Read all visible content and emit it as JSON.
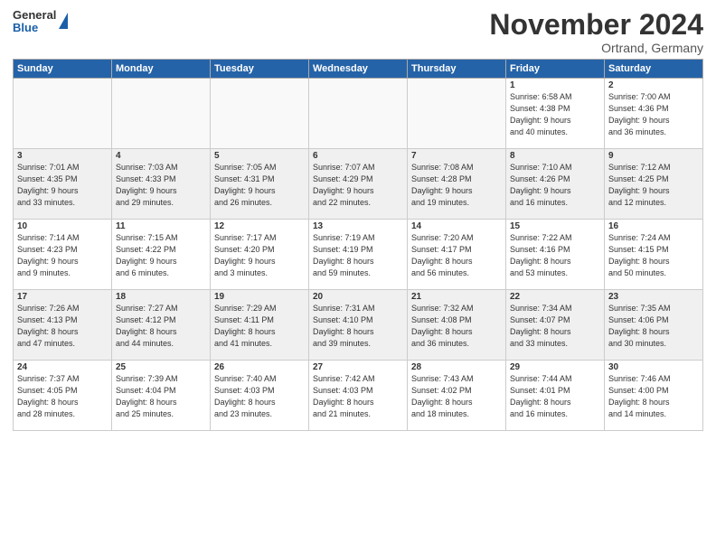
{
  "header": {
    "logo_general": "General",
    "logo_blue": "Blue",
    "month_title": "November 2024",
    "subtitle": "Ortrand, Germany"
  },
  "days_of_week": [
    "Sunday",
    "Monday",
    "Tuesday",
    "Wednesday",
    "Thursday",
    "Friday",
    "Saturday"
  ],
  "weeks": [
    [
      {
        "day": "",
        "info": ""
      },
      {
        "day": "",
        "info": ""
      },
      {
        "day": "",
        "info": ""
      },
      {
        "day": "",
        "info": ""
      },
      {
        "day": "",
        "info": ""
      },
      {
        "day": "1",
        "info": "Sunrise: 6:58 AM\nSunset: 4:38 PM\nDaylight: 9 hours\nand 40 minutes."
      },
      {
        "day": "2",
        "info": "Sunrise: 7:00 AM\nSunset: 4:36 PM\nDaylight: 9 hours\nand 36 minutes."
      }
    ],
    [
      {
        "day": "3",
        "info": "Sunrise: 7:01 AM\nSunset: 4:35 PM\nDaylight: 9 hours\nand 33 minutes."
      },
      {
        "day": "4",
        "info": "Sunrise: 7:03 AM\nSunset: 4:33 PM\nDaylight: 9 hours\nand 29 minutes."
      },
      {
        "day": "5",
        "info": "Sunrise: 7:05 AM\nSunset: 4:31 PM\nDaylight: 9 hours\nand 26 minutes."
      },
      {
        "day": "6",
        "info": "Sunrise: 7:07 AM\nSunset: 4:29 PM\nDaylight: 9 hours\nand 22 minutes."
      },
      {
        "day": "7",
        "info": "Sunrise: 7:08 AM\nSunset: 4:28 PM\nDaylight: 9 hours\nand 19 minutes."
      },
      {
        "day": "8",
        "info": "Sunrise: 7:10 AM\nSunset: 4:26 PM\nDaylight: 9 hours\nand 16 minutes."
      },
      {
        "day": "9",
        "info": "Sunrise: 7:12 AM\nSunset: 4:25 PM\nDaylight: 9 hours\nand 12 minutes."
      }
    ],
    [
      {
        "day": "10",
        "info": "Sunrise: 7:14 AM\nSunset: 4:23 PM\nDaylight: 9 hours\nand 9 minutes."
      },
      {
        "day": "11",
        "info": "Sunrise: 7:15 AM\nSunset: 4:22 PM\nDaylight: 9 hours\nand 6 minutes."
      },
      {
        "day": "12",
        "info": "Sunrise: 7:17 AM\nSunset: 4:20 PM\nDaylight: 9 hours\nand 3 minutes."
      },
      {
        "day": "13",
        "info": "Sunrise: 7:19 AM\nSunset: 4:19 PM\nDaylight: 8 hours\nand 59 minutes."
      },
      {
        "day": "14",
        "info": "Sunrise: 7:20 AM\nSunset: 4:17 PM\nDaylight: 8 hours\nand 56 minutes."
      },
      {
        "day": "15",
        "info": "Sunrise: 7:22 AM\nSunset: 4:16 PM\nDaylight: 8 hours\nand 53 minutes."
      },
      {
        "day": "16",
        "info": "Sunrise: 7:24 AM\nSunset: 4:15 PM\nDaylight: 8 hours\nand 50 minutes."
      }
    ],
    [
      {
        "day": "17",
        "info": "Sunrise: 7:26 AM\nSunset: 4:13 PM\nDaylight: 8 hours\nand 47 minutes."
      },
      {
        "day": "18",
        "info": "Sunrise: 7:27 AM\nSunset: 4:12 PM\nDaylight: 8 hours\nand 44 minutes."
      },
      {
        "day": "19",
        "info": "Sunrise: 7:29 AM\nSunset: 4:11 PM\nDaylight: 8 hours\nand 41 minutes."
      },
      {
        "day": "20",
        "info": "Sunrise: 7:31 AM\nSunset: 4:10 PM\nDaylight: 8 hours\nand 39 minutes."
      },
      {
        "day": "21",
        "info": "Sunrise: 7:32 AM\nSunset: 4:08 PM\nDaylight: 8 hours\nand 36 minutes."
      },
      {
        "day": "22",
        "info": "Sunrise: 7:34 AM\nSunset: 4:07 PM\nDaylight: 8 hours\nand 33 minutes."
      },
      {
        "day": "23",
        "info": "Sunrise: 7:35 AM\nSunset: 4:06 PM\nDaylight: 8 hours\nand 30 minutes."
      }
    ],
    [
      {
        "day": "24",
        "info": "Sunrise: 7:37 AM\nSunset: 4:05 PM\nDaylight: 8 hours\nand 28 minutes."
      },
      {
        "day": "25",
        "info": "Sunrise: 7:39 AM\nSunset: 4:04 PM\nDaylight: 8 hours\nand 25 minutes."
      },
      {
        "day": "26",
        "info": "Sunrise: 7:40 AM\nSunset: 4:03 PM\nDaylight: 8 hours\nand 23 minutes."
      },
      {
        "day": "27",
        "info": "Sunrise: 7:42 AM\nSunset: 4:03 PM\nDaylight: 8 hours\nand 21 minutes."
      },
      {
        "day": "28",
        "info": "Sunrise: 7:43 AM\nSunset: 4:02 PM\nDaylight: 8 hours\nand 18 minutes."
      },
      {
        "day": "29",
        "info": "Sunrise: 7:44 AM\nSunset: 4:01 PM\nDaylight: 8 hours\nand 16 minutes."
      },
      {
        "day": "30",
        "info": "Sunrise: 7:46 AM\nSunset: 4:00 PM\nDaylight: 8 hours\nand 14 minutes."
      }
    ]
  ]
}
